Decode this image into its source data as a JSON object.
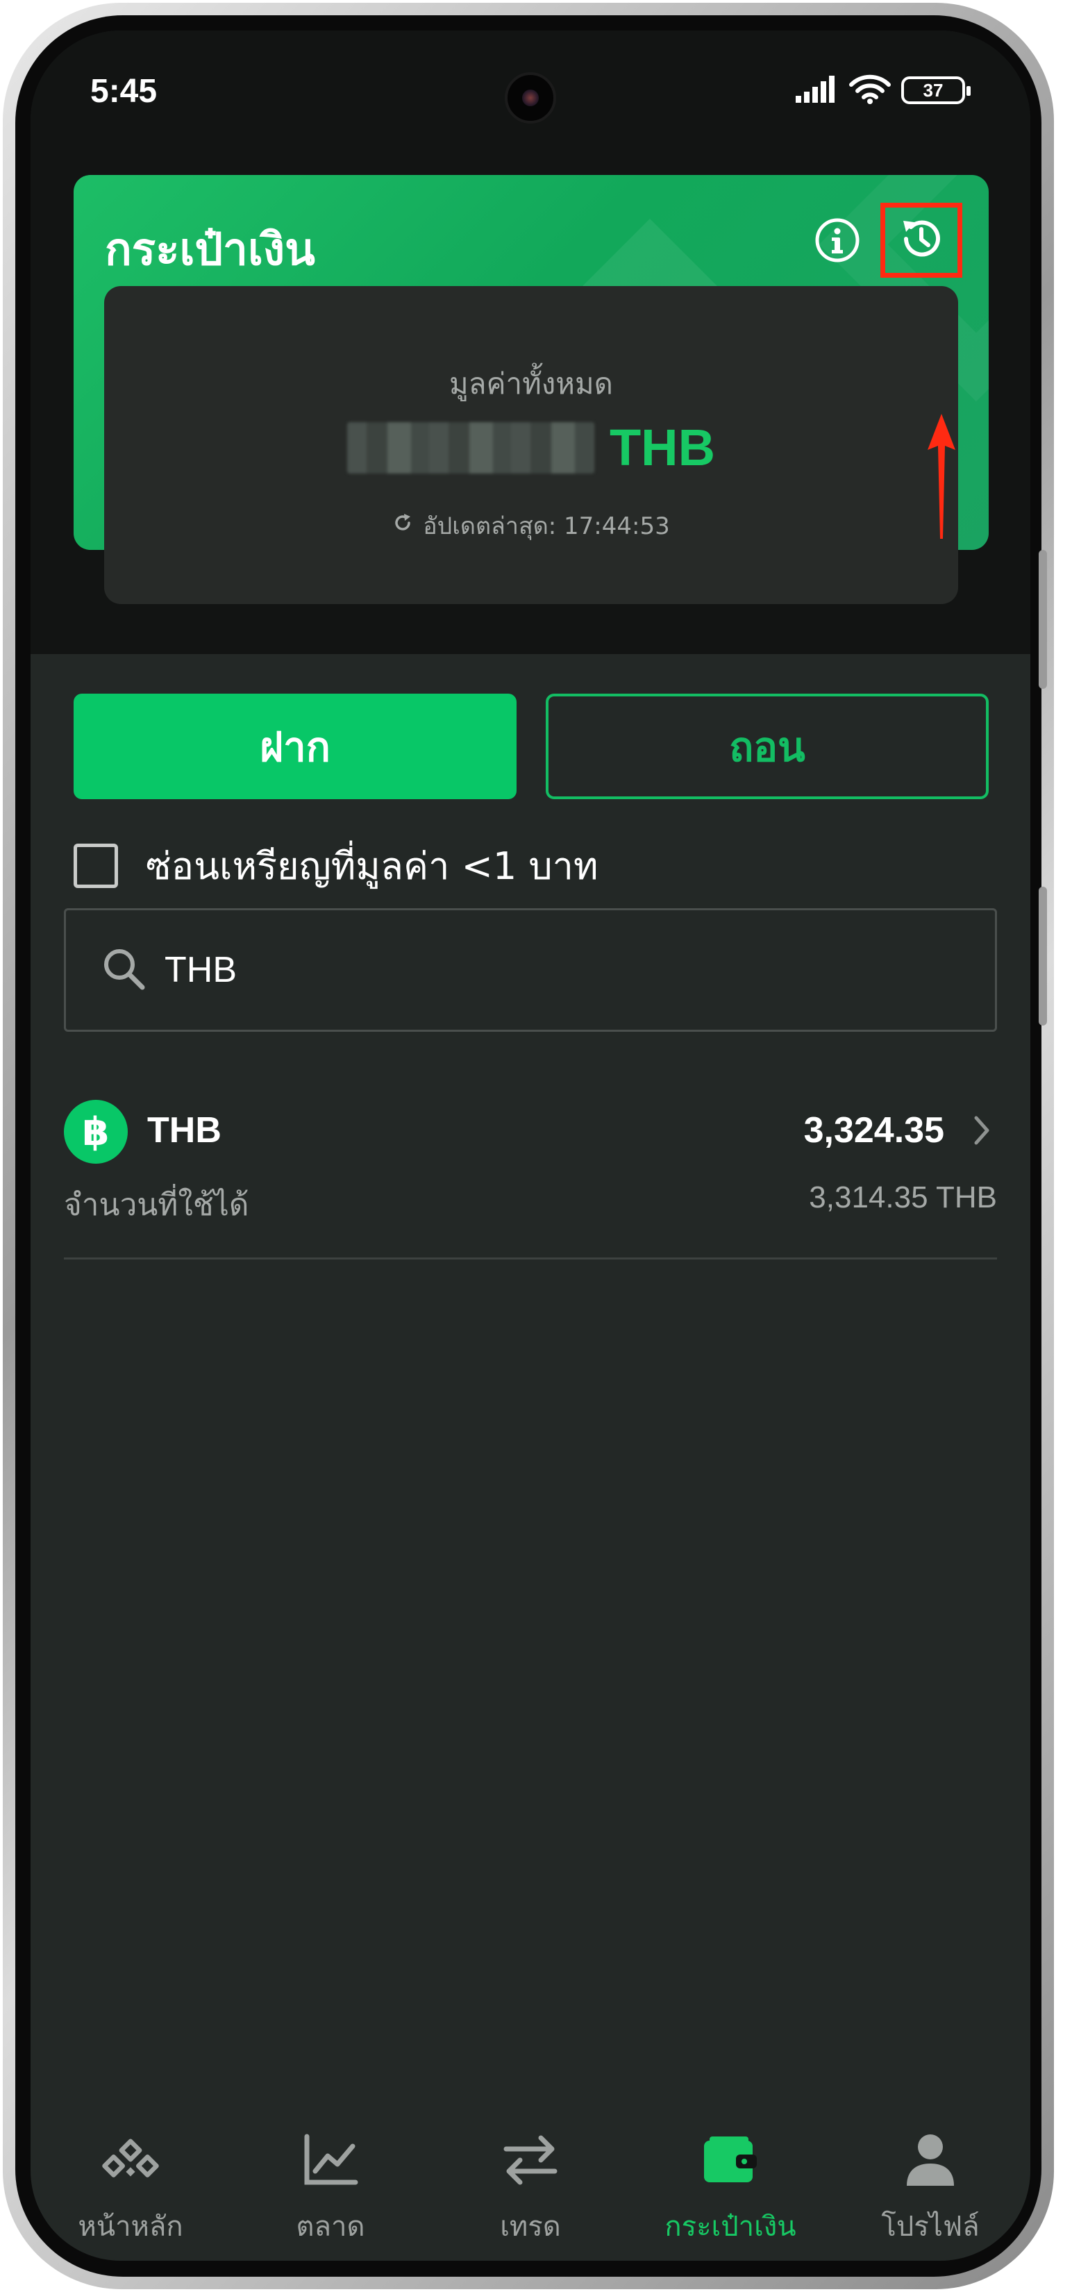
{
  "status_bar": {
    "time": "5:45",
    "battery": "37"
  },
  "wallet": {
    "title": "กระเป๋าเงิน",
    "icons": {
      "info": "info-icon",
      "history": "history-icon"
    },
    "balance_label": "มูลค่าทั้งหมด",
    "balance_currency": "THB",
    "last_update_label": "อัปเดตล่าสุด: 17:44:53"
  },
  "actions": {
    "deposit_label": "ฝาก",
    "withdraw_label": "ถอน"
  },
  "filter": {
    "hide_small_label": "ซ่อนเหรียญที่มูลค่า <1 บาท",
    "checked": false
  },
  "search": {
    "value": "THB"
  },
  "assets": [
    {
      "symbol": "THB",
      "icon": "baht-icon",
      "icon_glyph": "฿",
      "total": "3,324.35",
      "available_label": "จำนวนที่ใช้ได้",
      "available_value": "3,314.35 THB"
    }
  ],
  "nav": {
    "items": [
      {
        "label": "หน้าหลัก",
        "icon": "home-icon"
      },
      {
        "label": "ตลาด",
        "icon": "market-chart-icon"
      },
      {
        "label": "เทรด",
        "icon": "trade-swap-icon"
      },
      {
        "label": "กระเป๋าเงิน",
        "icon": "wallet-icon",
        "active": true
      },
      {
        "label": "โปรไฟล์",
        "icon": "profile-icon"
      }
    ]
  },
  "colors": {
    "accent": "#08c767",
    "background": "#232826",
    "annotation": "#ff2a12"
  }
}
